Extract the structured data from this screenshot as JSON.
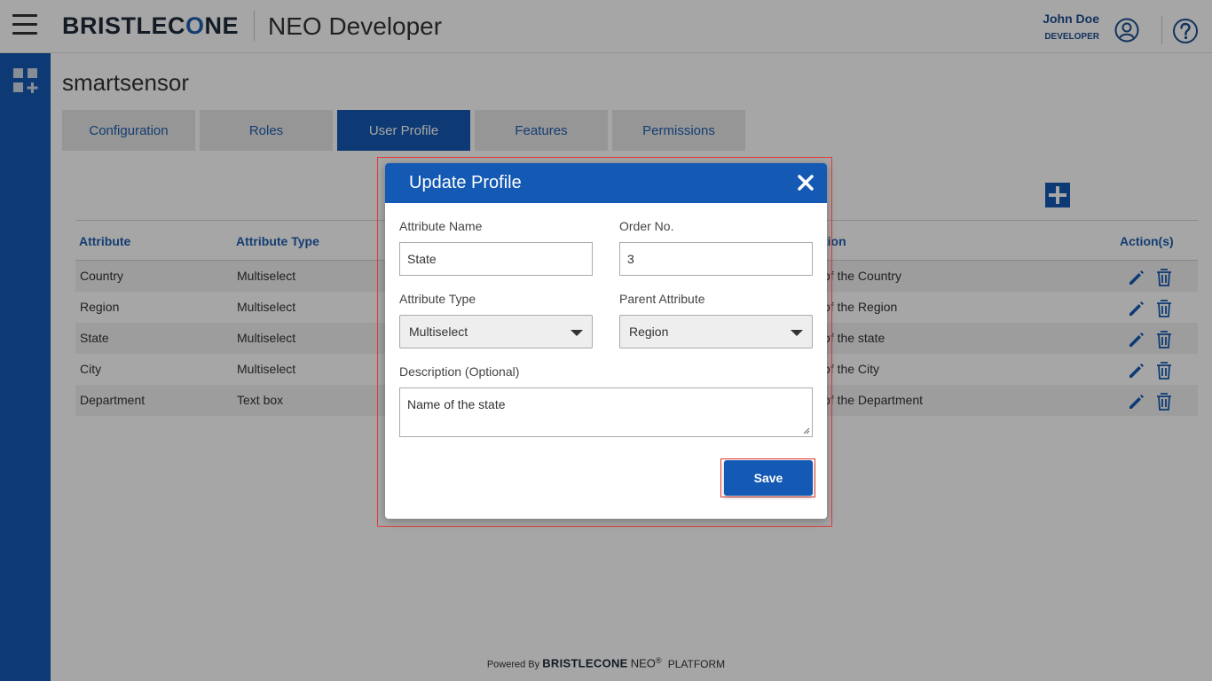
{
  "header": {
    "brand_left": "BRISTLEC",
    "brand_o": "O",
    "brand_right": "NE",
    "app_name": "NEO Developer",
    "user_name": "John Doe",
    "user_role": "DEVELOPER",
    "icons": {
      "menu": "hamburger-icon",
      "user": "user-circle-icon",
      "help": "help-circle-icon"
    }
  },
  "sidebar": {
    "icon": "apps-add-icon"
  },
  "page": {
    "title": "smartsensor",
    "tabs": [
      {
        "label": "Configuration",
        "active": false
      },
      {
        "label": "Roles",
        "active": false
      },
      {
        "label": "User Profile",
        "active": true
      },
      {
        "label": "Features",
        "active": false
      },
      {
        "label": "Permissions",
        "active": false
      }
    ]
  },
  "table": {
    "columns": {
      "attribute": "Attribute",
      "attribute_type": "Attribute Type",
      "description": "tion",
      "actions": "Action(s)"
    },
    "rows": [
      {
        "attribute": "Country",
        "type": "Multiselect",
        "description": "of the Country"
      },
      {
        "attribute": "Region",
        "type": "Multiselect",
        "description": "of the Region"
      },
      {
        "attribute": "State",
        "type": "Multiselect",
        "description": "of the state"
      },
      {
        "attribute": "City",
        "type": "Multiselect",
        "description": "of the City"
      },
      {
        "attribute": "Department",
        "type": "Text box",
        "description": "of the Department"
      }
    ]
  },
  "modal": {
    "title": "Update Profile",
    "fields": {
      "attribute_name_label": "Attribute Name",
      "attribute_name_value": "State",
      "order_label": "Order No.",
      "order_value": "3",
      "attribute_type_label": "Attribute Type",
      "attribute_type_value": "Multiselect",
      "parent_label": "Parent Attribute",
      "parent_value": "Region",
      "description_label": "Description (Optional)",
      "description_value": "Name of the state"
    },
    "save_label": "Save"
  },
  "footer": {
    "powered_by": "Powered By",
    "brand": "BRISTLECONE",
    "neo": "NEO",
    "reg": "®",
    "platform": "PLATFORM"
  },
  "colors": {
    "primary": "#1459b3",
    "highlight": "#e53935",
    "link": "#1f5fb0"
  }
}
